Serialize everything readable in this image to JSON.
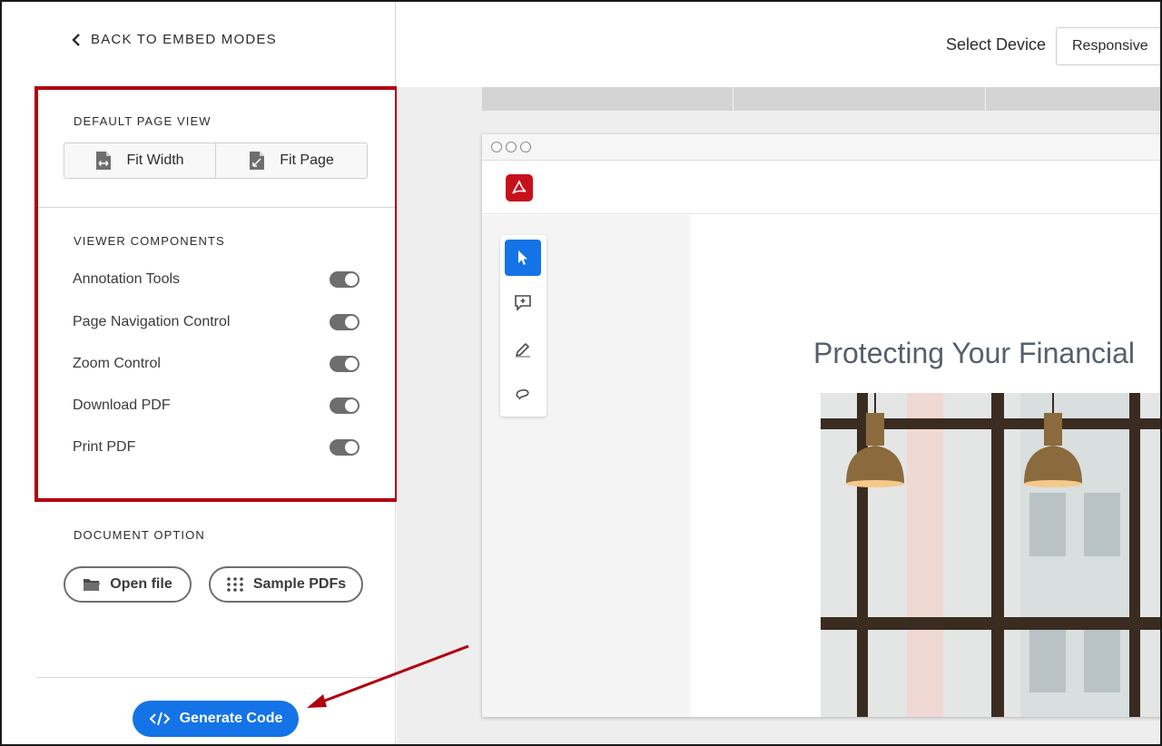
{
  "sidebar": {
    "back_label": "BACK TO EMBED MODES",
    "default_view": {
      "title": "DEFAULT PAGE VIEW",
      "options": [
        {
          "label": "Fit Width"
        },
        {
          "label": "Fit Page"
        }
      ]
    },
    "components": {
      "title": "VIEWER COMPONENTS",
      "items": [
        {
          "label": "Annotation Tools",
          "enabled": true
        },
        {
          "label": "Page Navigation Control",
          "enabled": true
        },
        {
          "label": "Zoom Control",
          "enabled": true
        },
        {
          "label": "Download PDF",
          "enabled": true
        },
        {
          "label": "Print PDF",
          "enabled": true
        }
      ]
    },
    "document": {
      "title": "DOCUMENT OPTION",
      "open_label": "Open file",
      "samples_label": "Sample PDFs"
    },
    "generate_label": "Generate Code"
  },
  "header": {
    "select_device_label": "Select Device",
    "device_value": "Responsive"
  },
  "viewer": {
    "document_title": "Protecting Your Financial",
    "tools": [
      "select-icon",
      "comment-icon",
      "draw-icon",
      "lasso-icon"
    ]
  },
  "colors": {
    "accent": "#1473e6",
    "highlight": "#b0000e",
    "acrobat": "#c8101c"
  }
}
